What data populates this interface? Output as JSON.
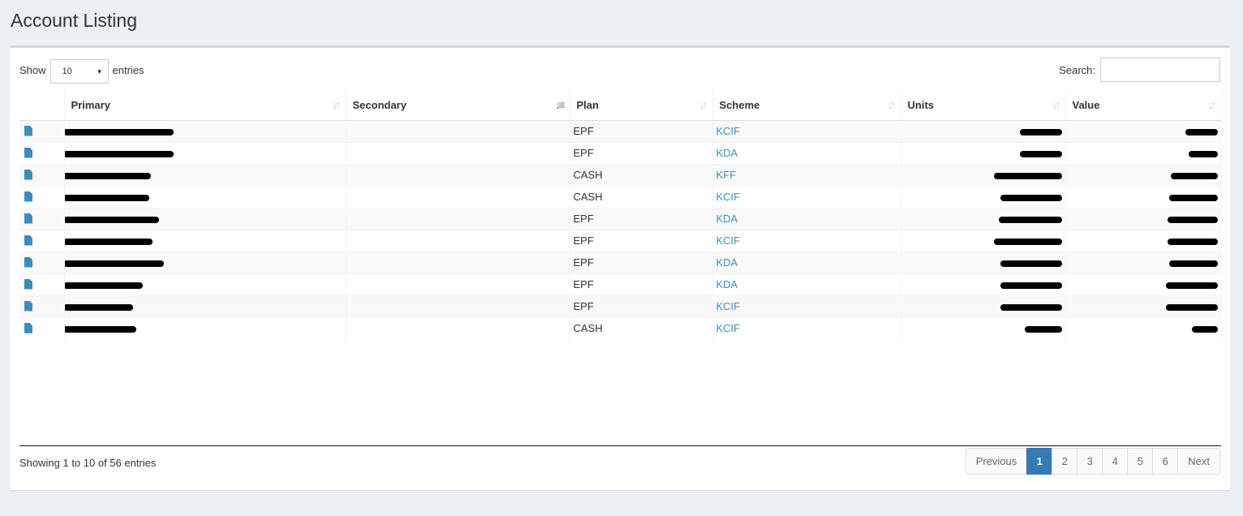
{
  "page": {
    "title": "Account Listing"
  },
  "controls": {
    "show_label": "Show",
    "entries_label": "entries",
    "page_size": "10",
    "search_label": "Search:",
    "search_value": ""
  },
  "table": {
    "columns": [
      "",
      "Primary",
      "Secondary",
      "Plan",
      "Scheme",
      "Units",
      "Value"
    ],
    "rows": [
      {
        "plan": "EPF",
        "scheme": "KCIF"
      },
      {
        "plan": "EPF",
        "scheme": "KDA"
      },
      {
        "plan": "CASH",
        "scheme": "KFF"
      },
      {
        "plan": "CASH",
        "scheme": "KCIF"
      },
      {
        "plan": "EPF",
        "scheme": "KDA"
      },
      {
        "plan": "EPF",
        "scheme": "KCIF"
      },
      {
        "plan": "EPF",
        "scheme": "KDA"
      },
      {
        "plan": "EPF",
        "scheme": "KDA"
      },
      {
        "plan": "EPF",
        "scheme": "KCIF"
      },
      {
        "plan": "CASH",
        "scheme": "KCIF"
      }
    ]
  },
  "footer": {
    "info": "Showing 1 to 10 of 56 entries",
    "pagination": [
      "Previous",
      "1",
      "2",
      "3",
      "4",
      "5",
      "6",
      "Next"
    ],
    "active_page": "1"
  },
  "colors": {
    "accent": "#3c8dbc",
    "active_page": "#337ab7",
    "background": "#ecf0f5"
  }
}
